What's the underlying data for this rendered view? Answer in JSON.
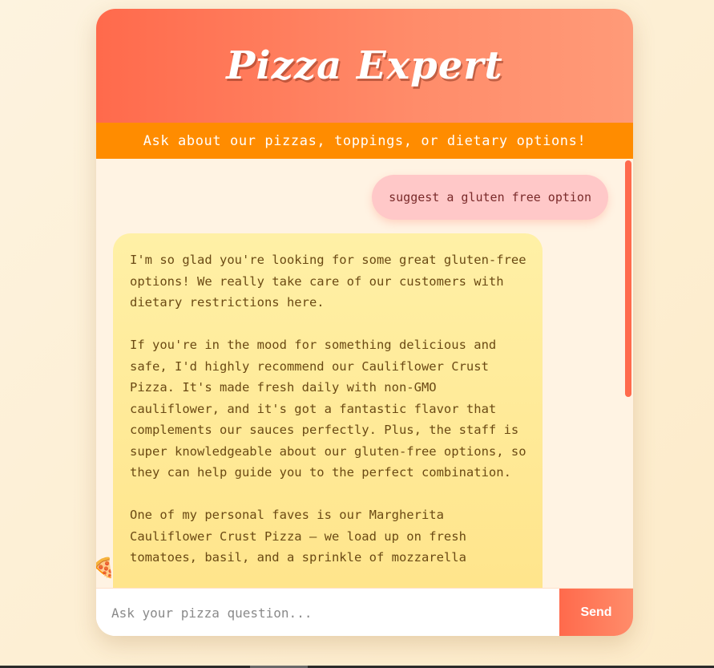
{
  "app": {
    "title": "Pizza Expert",
    "subtitle": "Ask about our pizzas, toppings, or dietary options!"
  },
  "messages": {
    "user": "suggest a gluten free option",
    "bot_paragraphs": [
      "I'm so glad you're looking for some great gluten-free options! We really take care of our customers with dietary restrictions here.",
      "If you're in the mood for something delicious and safe, I'd highly recommend our Cauliflower Crust Pizza. It's made fresh daily with non-GMO cauliflower, and it's got a fantastic flavor that complements our sauces perfectly. Plus, the staff is super knowledgeable about our gluten-free options, so they can help guide you to the perfect combination.",
      "One of my personal faves is our Margherita Cauliflower Crust Pizza – we load up on fresh tomatoes, basil, and a sprinkle of mozzarella"
    ],
    "bot_avatar_icon": "pizza-slice-icon",
    "bot_avatar_glyph": "🍕"
  },
  "input": {
    "placeholder": "Ask your pizza question...",
    "value": "",
    "send_label": "Send"
  },
  "colors": {
    "header_start": "#ff6a4c",
    "header_end": "#ff9a78",
    "subheader": "#ff8c00",
    "user_bubble": "#ffc8c8",
    "bot_bubble": "#ffe48a",
    "send_button": "#ff6a4c"
  }
}
